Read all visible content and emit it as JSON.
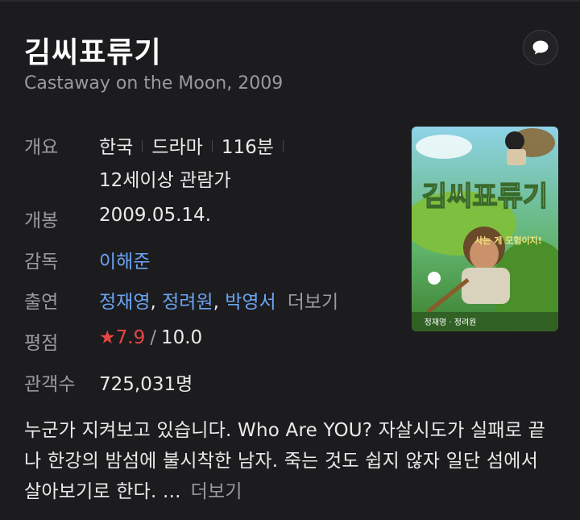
{
  "title": "김씨표류기",
  "subtitle": "Castaway on the Moon, 2009",
  "comment_icon": "speech-bubble-icon",
  "info": {
    "overview_label": "개요",
    "country": "한국",
    "genre": "드라마",
    "runtime": "116분",
    "rating_age": "12세이상 관람가",
    "release_label": "개봉",
    "release_date": "2009.05.14.",
    "director_label": "감독",
    "director": "이해준",
    "cast_label": "출연",
    "cast": [
      "정재영",
      "정려원",
      "박영서"
    ],
    "cast_more": "더보기",
    "score_label": "평점",
    "score_star": "★",
    "score": "7.9",
    "score_sep": "/",
    "score_max": "10.0",
    "audience_label": "관객수",
    "audience": "725,031명"
  },
  "poster": {
    "title_text": "김씨표류기",
    "tagline": "사는 게 모험이지!",
    "names": "정재영 · 정려원"
  },
  "summary": {
    "text": "누군가 지켜보고 있습니다. Who Are YOU? 자살시도가 실패로 끝나 한강의 밤섬에 불시착한 남자. 죽는 것도 쉽지 않자 일단 섬에서 살아보기로 한다. ...",
    "more": "더보기"
  },
  "colors": {
    "background": "#1c1c1e",
    "link": "#6ba4f3",
    "star": "#e74545",
    "muted": "#9a9a9f"
  }
}
